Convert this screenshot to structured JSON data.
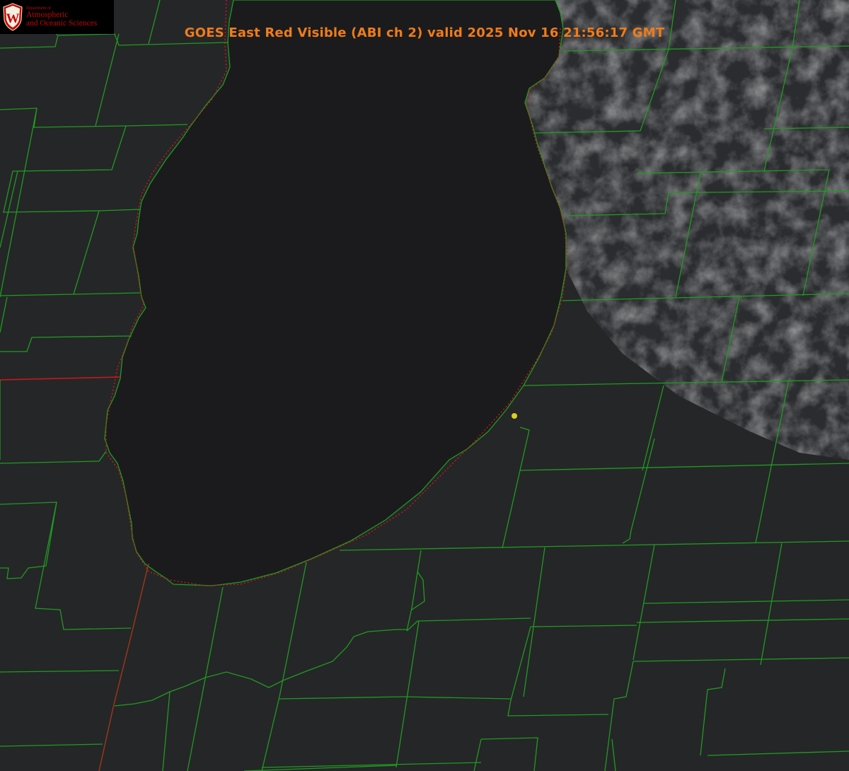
{
  "title": "GOES East Red Visible (ABI ch 2) valid 2025 Nov 16 21:56:17 GMT",
  "logo": {
    "department": "Department of",
    "line1": "Atmospheric",
    "line2": "and Oceanic Sciences",
    "crest_letter": "W"
  },
  "colors": {
    "title": "#f07c18",
    "county_lines": "#1f9b1f",
    "state_line": "#d01818",
    "marker": "#d8d020",
    "lake": "#1b1b1d",
    "land": "#252628"
  }
}
